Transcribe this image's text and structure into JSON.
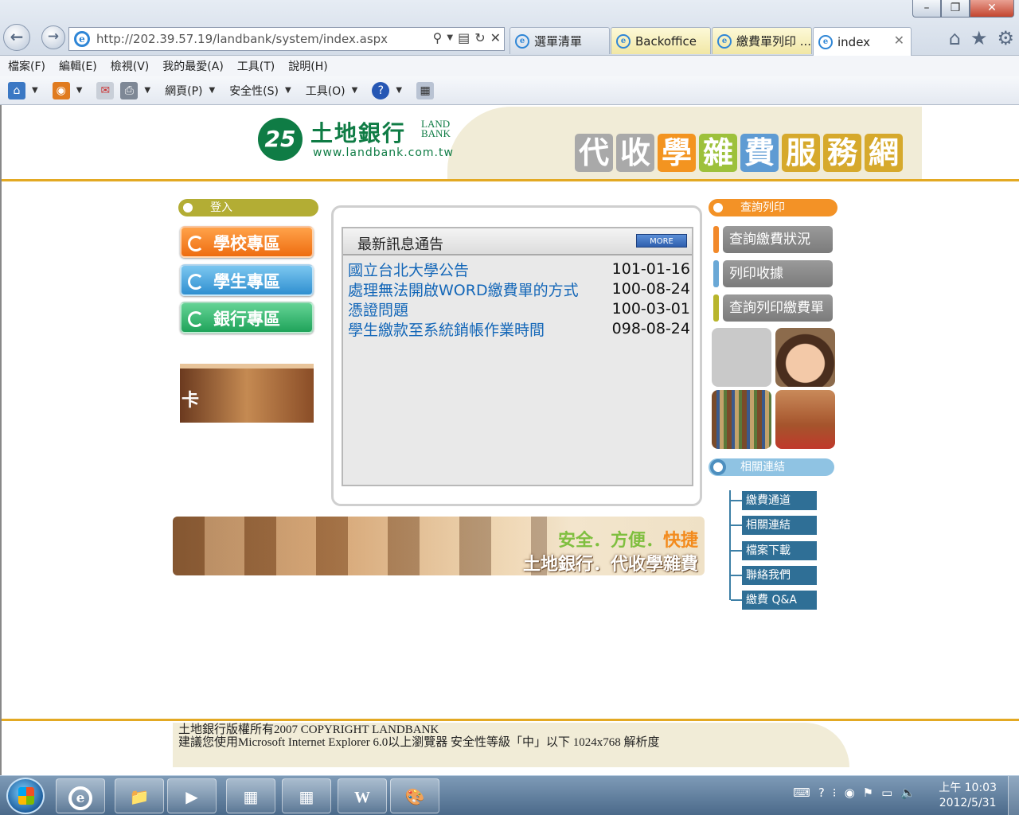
{
  "browser": {
    "address": "http://202.39.57.19/landbank/system/index.aspx",
    "tabs": [
      {
        "label": "選單清單",
        "style": "normal"
      },
      {
        "label": "Backoffice",
        "style": "yellow"
      },
      {
        "label": "繳費單列印 ...",
        "style": "yellow"
      },
      {
        "label": "index",
        "style": "active"
      }
    ],
    "menu": [
      "檔案(F)",
      "編輯(E)",
      "檢視(V)",
      "我的最愛(A)",
      "工具(T)",
      "說明(H)"
    ],
    "commands": {
      "page": "網頁(P)",
      "safety": "安全性(S)",
      "tools": "工具(O)"
    }
  },
  "site": {
    "logo_mark": "25",
    "logo_cn": "土地銀行",
    "logo_en_line1": "LAND",
    "logo_en_line2": "BANK",
    "logo_url": "www.landbank.com.tw",
    "title_chars": [
      {
        "char": "代",
        "color": "#a9a9a9"
      },
      {
        "char": "收",
        "color": "#a9a9a9"
      },
      {
        "char": "學",
        "color": "#f39420"
      },
      {
        "char": "雜",
        "color": "#9dc13b"
      },
      {
        "char": "費",
        "color": "#5e9bd3"
      },
      {
        "char": "服",
        "color": "#d6a92c"
      },
      {
        "char": "務",
        "color": "#d6a92c"
      },
      {
        "char": "網",
        "color": "#d6a92c"
      }
    ]
  },
  "left": {
    "login_label": "登入",
    "buttons": [
      {
        "label": "學校專區",
        "color": "#f27a1a"
      },
      {
        "label": "學生專區",
        "color": "#3f9fd8"
      },
      {
        "label": "銀行專區",
        "color": "#2fb36a"
      }
    ],
    "card_text": "卡"
  },
  "news": {
    "title": "最新訊息通告",
    "more": "MORE",
    "items": [
      {
        "text": "國立台北大學公告",
        "date": "101-01-16"
      },
      {
        "text": "處理無法開啟WORD繳費單的方式",
        "date": "100-08-24"
      },
      {
        "text": "憑證問題",
        "date": "100-03-01"
      },
      {
        "text": "學生繳款至系統銷帳作業時間",
        "date": "098-08-24"
      }
    ]
  },
  "banner": {
    "line1_a": "安全．方便．",
    "line1_b": "快捷",
    "line2": "土地銀行．代收學雜費"
  },
  "right": {
    "query_label": "查詢列印",
    "buttons": [
      {
        "label": "查詢繳費狀況",
        "bar": "#f2892a"
      },
      {
        "label": "列印收據",
        "bar": "#6aa8d6"
      },
      {
        "label": "查詢列印繳費單",
        "bar": "#b8b52c"
      }
    ],
    "related_label": "相關連結",
    "links": [
      "繳費通道",
      "相關連結",
      "檔案下載",
      "聯絡我們",
      "繳費 Q&A"
    ]
  },
  "footer": {
    "line1": "土地銀行版權所有2007 COPYRIGHT LANDBANK",
    "line2": "建議您使用Microsoft Internet Explorer 6.0以上瀏覽器 安全性等級「中」以下 1024x768 解析度"
  },
  "taskbar": {
    "time": "上午 10:03",
    "date": "2012/5/31"
  },
  "colors": {
    "gold_line": "#e3a923",
    "brand_green": "#0f7c45",
    "link_blue": "#1467b8"
  }
}
